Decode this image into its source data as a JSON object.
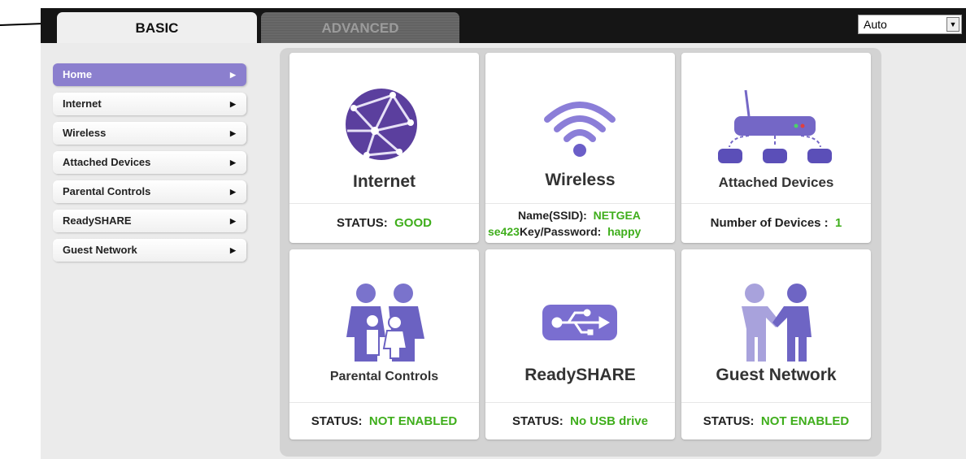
{
  "tabs": {
    "basic": "BASIC",
    "advanced": "ADVANCED"
  },
  "language": {
    "selected": "Auto"
  },
  "sidebar": {
    "items": [
      {
        "label": "Home"
      },
      {
        "label": "Internet"
      },
      {
        "label": "Wireless"
      },
      {
        "label": "Attached Devices"
      },
      {
        "label": "Parental Controls"
      },
      {
        "label": "ReadySHARE"
      },
      {
        "label": "Guest Network"
      }
    ]
  },
  "tiles": {
    "internet": {
      "title": "Internet",
      "status_label": "STATUS:",
      "status_value": "GOOD"
    },
    "wireless": {
      "title": "Wireless",
      "ssid_label": "Name(SSID):",
      "ssid_value": "NETGEA",
      "ssid_value_cont": "se423",
      "key_label": "Key/Password:",
      "key_value": "happy"
    },
    "attached": {
      "title": "Attached Devices",
      "count_label": "Number of Devices :",
      "count_value": "1"
    },
    "parental": {
      "title": "Parental Controls",
      "status_label": "STATUS:",
      "status_value": "NOT ENABLED"
    },
    "readyshare": {
      "title": "ReadySHARE",
      "status_label": "STATUS:",
      "status_value": "No USB drive"
    },
    "guest": {
      "title": "Guest Network",
      "status_label": "STATUS:",
      "status_value": "NOT ENABLED"
    }
  },
  "colors": {
    "accent_purple": "#7f6fd0",
    "status_green": "#3fae1c",
    "topbar": "#151515"
  },
  "icons": [
    "globe-icon",
    "wifi-icon",
    "router-network-icon",
    "family-icon",
    "usb-icon",
    "handshake-icon"
  ]
}
